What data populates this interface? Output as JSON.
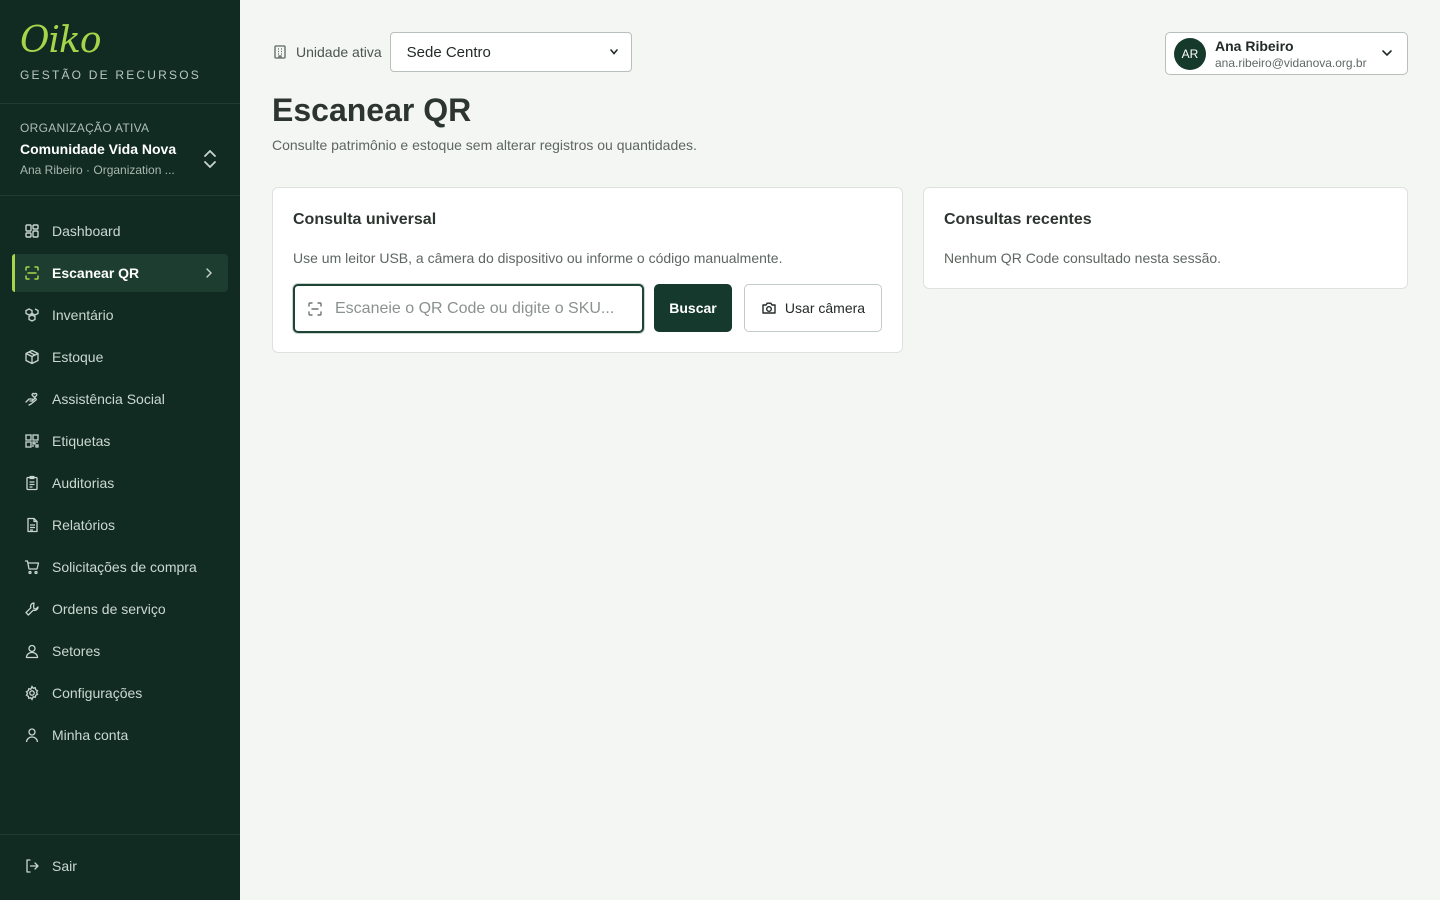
{
  "brand": {
    "logo": "Oiko",
    "subtitle": "GESTÃO DE RECURSOS",
    "accent": "#a8d44a"
  },
  "organization": {
    "label": "ORGANIZAÇÃO ATIVA",
    "name": "Comunidade Vida Nova",
    "sub": "Ana Ribeiro · Organization ..."
  },
  "nav": {
    "items": [
      {
        "label": "Dashboard",
        "icon": "dashboard-icon"
      },
      {
        "label": "Escanear QR",
        "icon": "scan-icon",
        "active": true
      },
      {
        "label": "Inventário",
        "icon": "boxes-icon"
      },
      {
        "label": "Estoque",
        "icon": "package-icon"
      },
      {
        "label": "Assistência Social",
        "icon": "hand-heart-icon"
      },
      {
        "label": "Etiquetas",
        "icon": "qr-code-icon"
      },
      {
        "label": "Auditorias",
        "icon": "clipboard-icon"
      },
      {
        "label": "Relatórios",
        "icon": "file-text-icon"
      },
      {
        "label": "Solicitações de compra",
        "icon": "cart-icon"
      },
      {
        "label": "Ordens de serviço",
        "icon": "wrench-icon"
      },
      {
        "label": "Setores",
        "icon": "users-icon"
      },
      {
        "label": "Configurações",
        "icon": "gear-icon"
      },
      {
        "label": "Minha conta",
        "icon": "user-icon"
      }
    ],
    "logout": "Sair"
  },
  "topbar": {
    "unit_label": "Unidade ativa",
    "unit_value": "Sede Centro"
  },
  "user": {
    "initials": "AR",
    "name": "Ana Ribeiro",
    "email": "ana.ribeiro@vidanova.org.br"
  },
  "page": {
    "title": "Escanear QR",
    "subtitle": "Consulte patrimônio e estoque sem alterar registros ou quantidades."
  },
  "lookup_card": {
    "title": "Consulta universal",
    "description": "Use um leitor USB, a câmera do dispositivo ou informe o código manualmente.",
    "input_placeholder": "Escaneie o QR Code ou digite o SKU...",
    "search_label": "Buscar",
    "camera_label": "Usar câmera"
  },
  "recent_card": {
    "title": "Consultas recentes",
    "empty_text": "Nenhum QR Code consultado nesta sessão."
  },
  "colors": {
    "sidebar_bg": "#112b22",
    "primary": "#15392c",
    "page_bg": "#f4f6f4"
  }
}
